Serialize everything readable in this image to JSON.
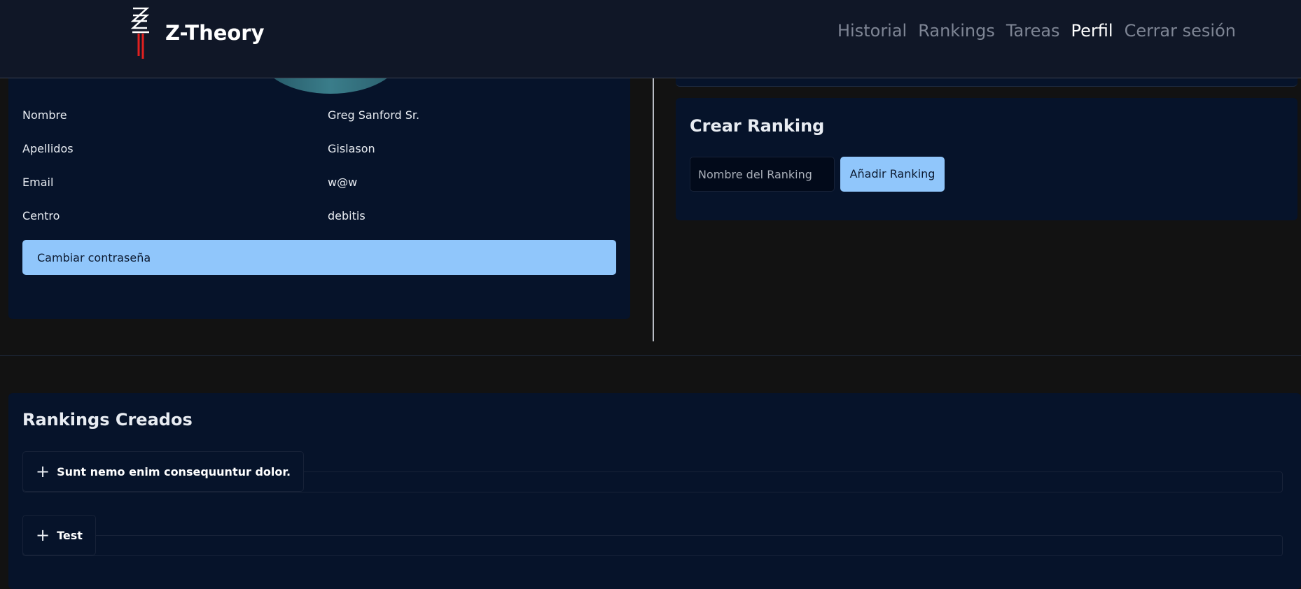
{
  "header": {
    "brand": "Z-Theory",
    "nav": [
      {
        "label": "Historial",
        "active": false
      },
      {
        "label": "Rankings",
        "active": false
      },
      {
        "label": "Tareas",
        "active": false
      },
      {
        "label": "Perfil",
        "active": true
      },
      {
        "label": "Cerrar sesión",
        "active": false
      }
    ]
  },
  "profile": {
    "fields": [
      {
        "label": "Nombre",
        "value": "Greg Sanford Sr."
      },
      {
        "label": "Apellidos",
        "value": "Gislason"
      },
      {
        "label": "Email",
        "value": "w@w"
      },
      {
        "label": "Centro",
        "value": "debitis"
      }
    ],
    "change_password_label": "Cambiar contraseña"
  },
  "create_ranking": {
    "title": "Crear Ranking",
    "input_placeholder": "Nombre del Ranking",
    "add_label": "Añadir Ranking"
  },
  "rankings_created": {
    "title": "Rankings Creados",
    "items": [
      {
        "label": "Sunt nemo enim consequuntur dolor."
      },
      {
        "label": "Test"
      }
    ]
  },
  "colors": {
    "accent": "#90c6fb",
    "card_bg": "#06132a",
    "header_bg": "#101727",
    "page_bg": "#121212"
  }
}
